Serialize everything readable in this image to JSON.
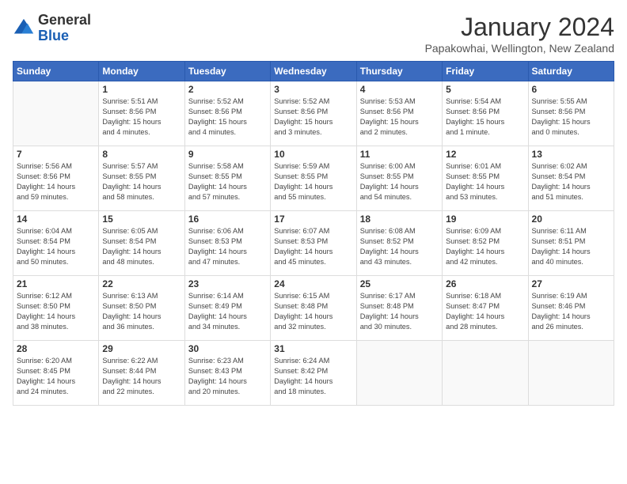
{
  "header": {
    "logo_general": "General",
    "logo_blue": "Blue",
    "title": "January 2024",
    "location": "Papakowhai, Wellington, New Zealand"
  },
  "days_of_week": [
    "Sunday",
    "Monday",
    "Tuesday",
    "Wednesday",
    "Thursday",
    "Friday",
    "Saturday"
  ],
  "weeks": [
    [
      {
        "day": "",
        "info": ""
      },
      {
        "day": "1",
        "info": "Sunrise: 5:51 AM\nSunset: 8:56 PM\nDaylight: 15 hours\nand 4 minutes."
      },
      {
        "day": "2",
        "info": "Sunrise: 5:52 AM\nSunset: 8:56 PM\nDaylight: 15 hours\nand 4 minutes."
      },
      {
        "day": "3",
        "info": "Sunrise: 5:52 AM\nSunset: 8:56 PM\nDaylight: 15 hours\nand 3 minutes."
      },
      {
        "day": "4",
        "info": "Sunrise: 5:53 AM\nSunset: 8:56 PM\nDaylight: 15 hours\nand 2 minutes."
      },
      {
        "day": "5",
        "info": "Sunrise: 5:54 AM\nSunset: 8:56 PM\nDaylight: 15 hours\nand 1 minute."
      },
      {
        "day": "6",
        "info": "Sunrise: 5:55 AM\nSunset: 8:56 PM\nDaylight: 15 hours\nand 0 minutes."
      }
    ],
    [
      {
        "day": "7",
        "info": "Sunrise: 5:56 AM\nSunset: 8:56 PM\nDaylight: 14 hours\nand 59 minutes."
      },
      {
        "day": "8",
        "info": "Sunrise: 5:57 AM\nSunset: 8:55 PM\nDaylight: 14 hours\nand 58 minutes."
      },
      {
        "day": "9",
        "info": "Sunrise: 5:58 AM\nSunset: 8:55 PM\nDaylight: 14 hours\nand 57 minutes."
      },
      {
        "day": "10",
        "info": "Sunrise: 5:59 AM\nSunset: 8:55 PM\nDaylight: 14 hours\nand 55 minutes."
      },
      {
        "day": "11",
        "info": "Sunrise: 6:00 AM\nSunset: 8:55 PM\nDaylight: 14 hours\nand 54 minutes."
      },
      {
        "day": "12",
        "info": "Sunrise: 6:01 AM\nSunset: 8:55 PM\nDaylight: 14 hours\nand 53 minutes."
      },
      {
        "day": "13",
        "info": "Sunrise: 6:02 AM\nSunset: 8:54 PM\nDaylight: 14 hours\nand 51 minutes."
      }
    ],
    [
      {
        "day": "14",
        "info": "Sunrise: 6:04 AM\nSunset: 8:54 PM\nDaylight: 14 hours\nand 50 minutes."
      },
      {
        "day": "15",
        "info": "Sunrise: 6:05 AM\nSunset: 8:54 PM\nDaylight: 14 hours\nand 48 minutes."
      },
      {
        "day": "16",
        "info": "Sunrise: 6:06 AM\nSunset: 8:53 PM\nDaylight: 14 hours\nand 47 minutes."
      },
      {
        "day": "17",
        "info": "Sunrise: 6:07 AM\nSunset: 8:53 PM\nDaylight: 14 hours\nand 45 minutes."
      },
      {
        "day": "18",
        "info": "Sunrise: 6:08 AM\nSunset: 8:52 PM\nDaylight: 14 hours\nand 43 minutes."
      },
      {
        "day": "19",
        "info": "Sunrise: 6:09 AM\nSunset: 8:52 PM\nDaylight: 14 hours\nand 42 minutes."
      },
      {
        "day": "20",
        "info": "Sunrise: 6:11 AM\nSunset: 8:51 PM\nDaylight: 14 hours\nand 40 minutes."
      }
    ],
    [
      {
        "day": "21",
        "info": "Sunrise: 6:12 AM\nSunset: 8:50 PM\nDaylight: 14 hours\nand 38 minutes."
      },
      {
        "day": "22",
        "info": "Sunrise: 6:13 AM\nSunset: 8:50 PM\nDaylight: 14 hours\nand 36 minutes."
      },
      {
        "day": "23",
        "info": "Sunrise: 6:14 AM\nSunset: 8:49 PM\nDaylight: 14 hours\nand 34 minutes."
      },
      {
        "day": "24",
        "info": "Sunrise: 6:15 AM\nSunset: 8:48 PM\nDaylight: 14 hours\nand 32 minutes."
      },
      {
        "day": "25",
        "info": "Sunrise: 6:17 AM\nSunset: 8:48 PM\nDaylight: 14 hours\nand 30 minutes."
      },
      {
        "day": "26",
        "info": "Sunrise: 6:18 AM\nSunset: 8:47 PM\nDaylight: 14 hours\nand 28 minutes."
      },
      {
        "day": "27",
        "info": "Sunrise: 6:19 AM\nSunset: 8:46 PM\nDaylight: 14 hours\nand 26 minutes."
      }
    ],
    [
      {
        "day": "28",
        "info": "Sunrise: 6:20 AM\nSunset: 8:45 PM\nDaylight: 14 hours\nand 24 minutes."
      },
      {
        "day": "29",
        "info": "Sunrise: 6:22 AM\nSunset: 8:44 PM\nDaylight: 14 hours\nand 22 minutes."
      },
      {
        "day": "30",
        "info": "Sunrise: 6:23 AM\nSunset: 8:43 PM\nDaylight: 14 hours\nand 20 minutes."
      },
      {
        "day": "31",
        "info": "Sunrise: 6:24 AM\nSunset: 8:42 PM\nDaylight: 14 hours\nand 18 minutes."
      },
      {
        "day": "",
        "info": ""
      },
      {
        "day": "",
        "info": ""
      },
      {
        "day": "",
        "info": ""
      }
    ]
  ]
}
